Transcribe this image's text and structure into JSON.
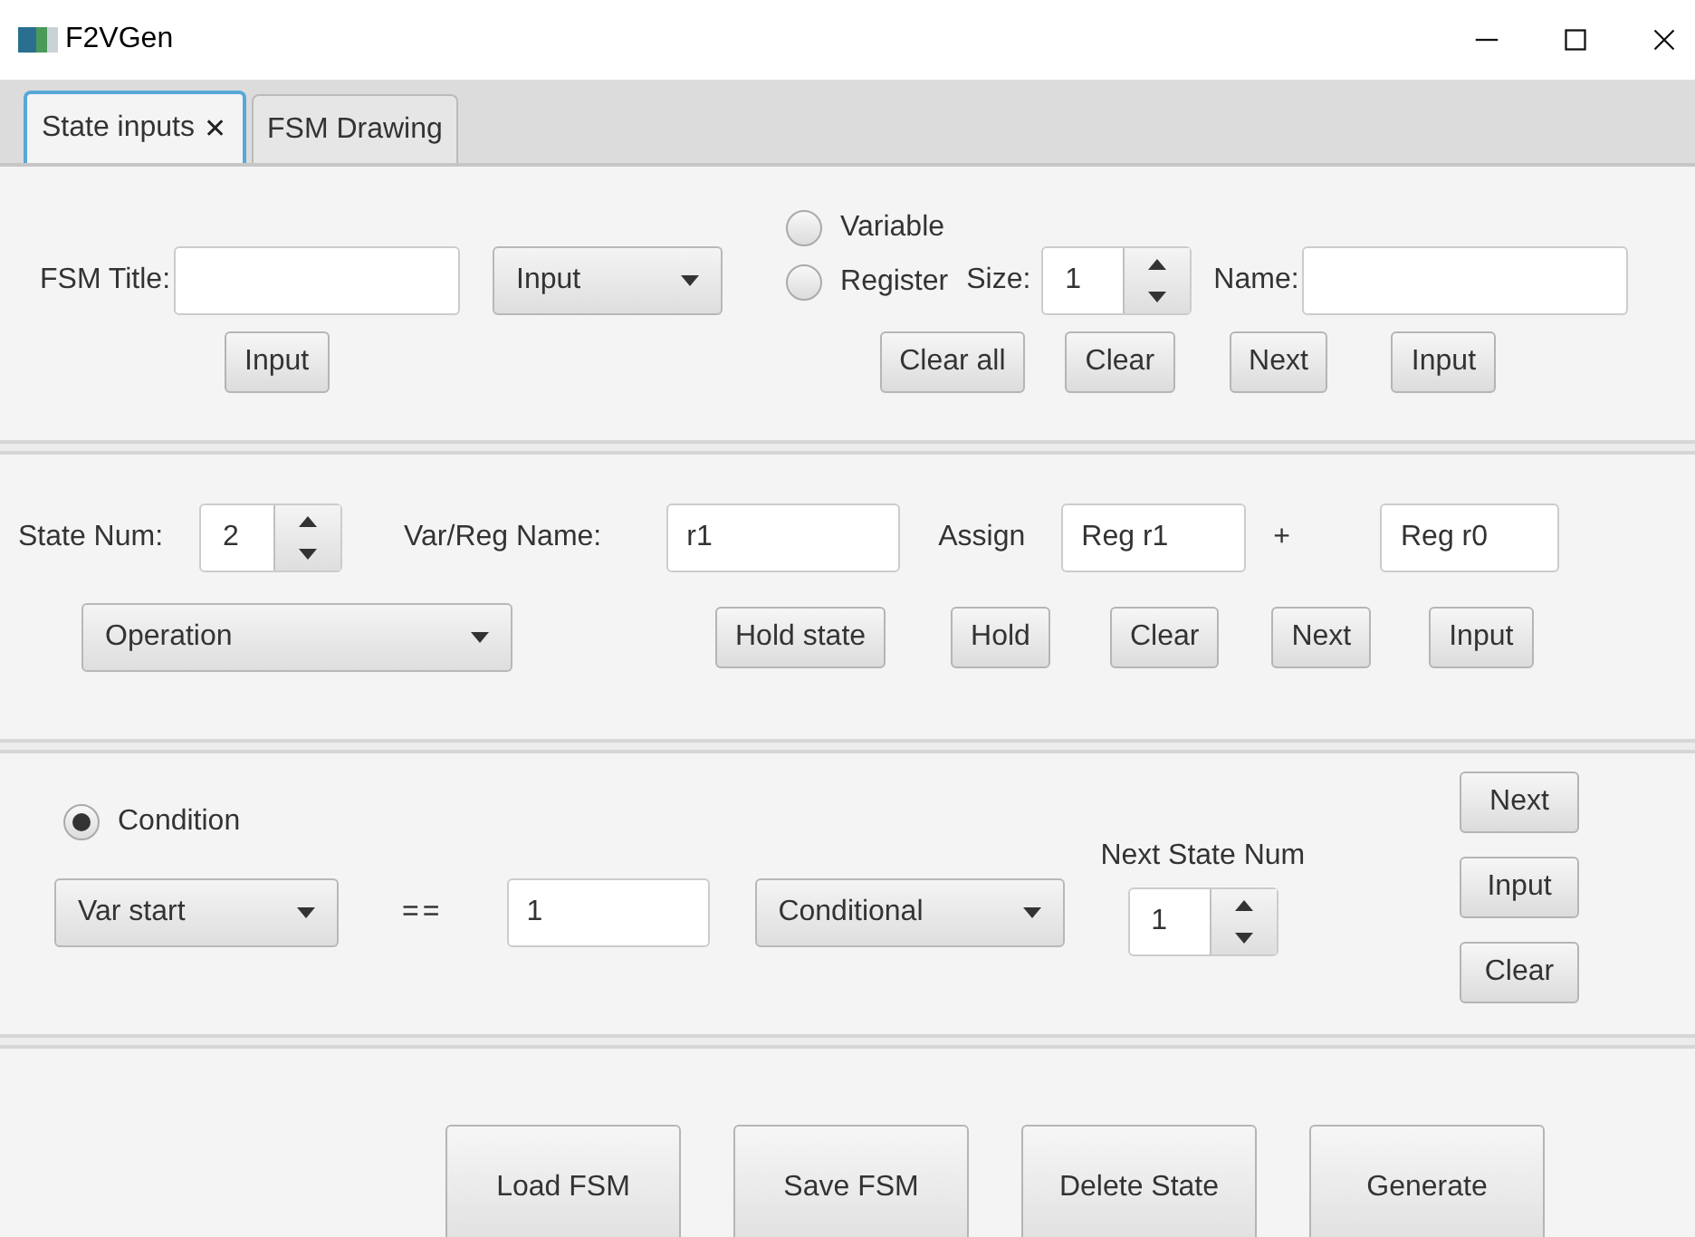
{
  "window": {
    "title": "F2VGen"
  },
  "tabs": [
    {
      "label": "State inputs",
      "close": "✕",
      "selected": true
    },
    {
      "label": "FSM Drawing",
      "selected": false
    }
  ],
  "declaration": {
    "title_label": "FSM Title:",
    "type_dropdown": "Input",
    "input_button": "Input",
    "radios": [
      {
        "label": "Variable",
        "selected": false
      },
      {
        "label": "Register",
        "selected": false
      }
    ],
    "size_label": "Size:",
    "size_value": "1",
    "name_label": "Name:",
    "buttons": [
      "Clear all",
      "Clear",
      "Next",
      "Input"
    ]
  },
  "operation": {
    "state_num_label": "State Num:",
    "state_num": "2",
    "name_label": "Var/Reg Name:",
    "name_value": "r1",
    "assign_label": "Assign",
    "operand_1": "Reg r1",
    "operator": "+",
    "operand_2": "Reg r0",
    "dropdown": "Operation",
    "buttons": [
      "Hold state",
      "Hold",
      "Clear",
      "Next",
      "Input"
    ]
  },
  "condition": {
    "radio": {
      "label": "Condition",
      "selected": true
    },
    "variable_dropdown": "Var start",
    "comparator": "==",
    "value": "1",
    "type_dropdown": "Conditional",
    "next_state_label": "Next State Num",
    "next_state": "1",
    "buttons": [
      "Next",
      "Input",
      "Clear"
    ]
  },
  "actions": [
    "Load FSM",
    "Save FSM",
    "Delete State",
    "Generate"
  ]
}
